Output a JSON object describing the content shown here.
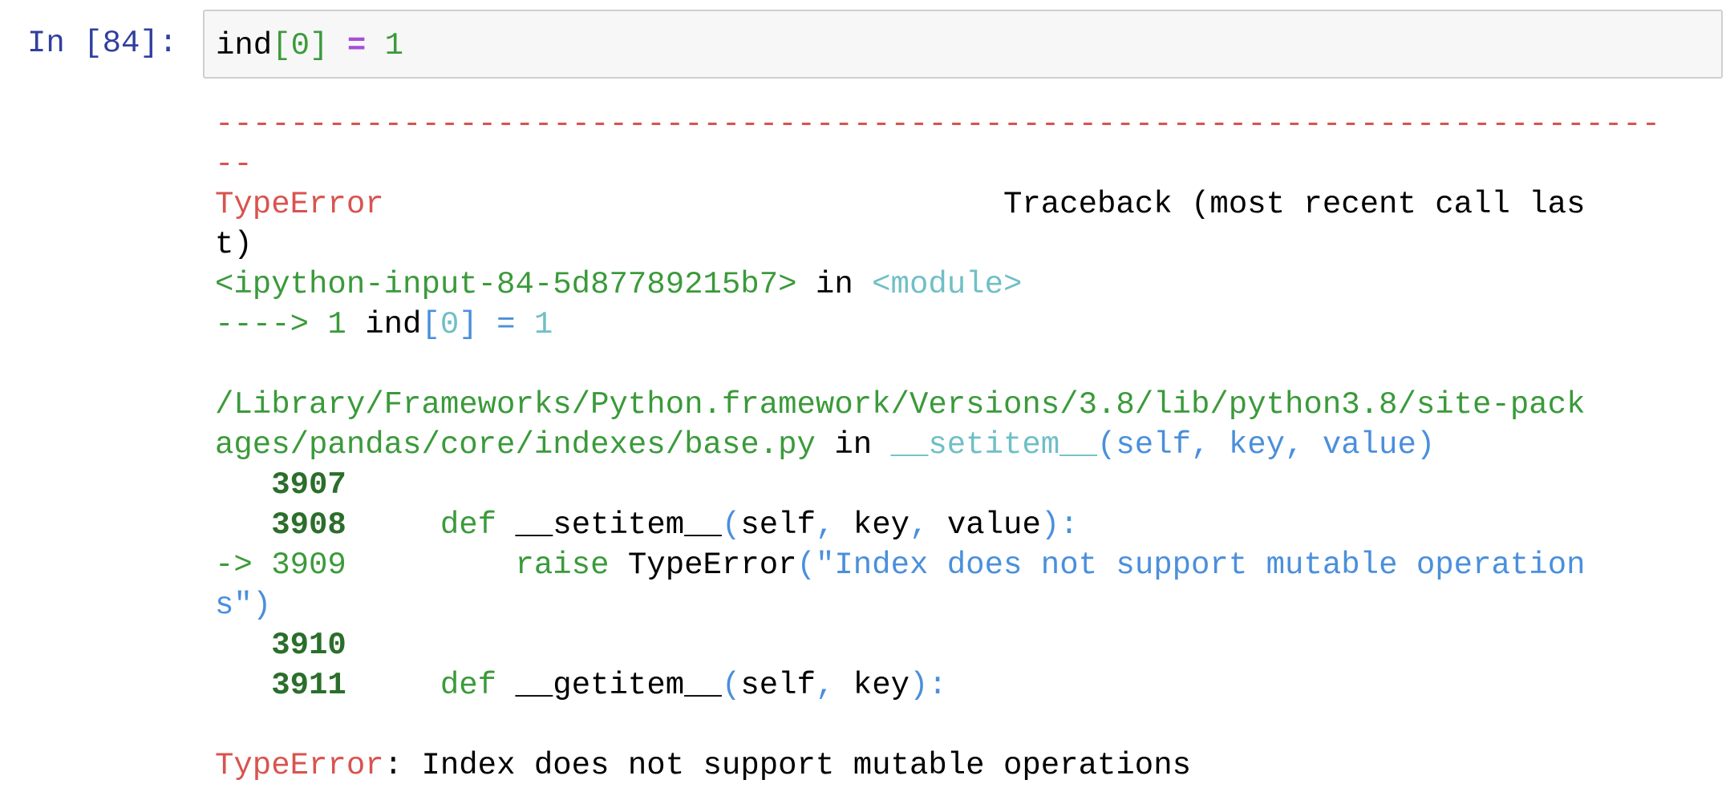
{
  "prompt": "In [84]:",
  "input": {
    "var": "ind",
    "bracket_open": "[",
    "index": "0",
    "bracket_close": "]",
    "op": " = ",
    "value": "1"
  },
  "traceback": {
    "dashes_line1": "-----------------------------------------------------------------------------",
    "dashes_line2": "--",
    "error_name": "TypeError",
    "header_gap": "                                 ",
    "header_text": "Traceback (most recent call las",
    "header_wrap": "t)",
    "frame1": {
      "location": "<ipython-input-84-5d87789215b7>",
      "in": " in ",
      "scope": "<module>",
      "arrow": "----> 1 ",
      "code_var": "ind",
      "code_open": "[",
      "code_index": "0",
      "code_close": "]",
      "code_op": " = ",
      "code_value": "1"
    },
    "frame2": {
      "path_line1": "/Library/Frameworks/Python.framework/Versions/3.8/lib/python3.8/site-pack",
      "path_line2": "ages/pandas/core/indexes/base.py",
      "in": " in ",
      "func": "__setitem__",
      "args": "(self, key, value)",
      "lines": [
        {
          "num": "3907",
          "code": ""
        },
        {
          "num": "3908",
          "kw": "def",
          "name": "__setitem__",
          "open": "(",
          "a1": "self",
          "c1": ", ",
          "a2": "key",
          "c2": ", ",
          "a3": "value",
          "close": "):"
        },
        {
          "arrow": "-> 3909",
          "kw": "raise",
          "name": "TypeError",
          "open": "(",
          "str": "\"Index does not support mutable operation",
          "str_wrap": "s\"",
          "close": ")"
        },
        {
          "num": "3910",
          "code": ""
        },
        {
          "num": "3911",
          "kw": "def",
          "name": "__getitem__",
          "open": "(",
          "a1": "self",
          "c1": ", ",
          "a2": "key",
          "close": "):"
        }
      ]
    },
    "final_error_name": "TypeError",
    "final_message": ": Index does not support mutable operations"
  }
}
